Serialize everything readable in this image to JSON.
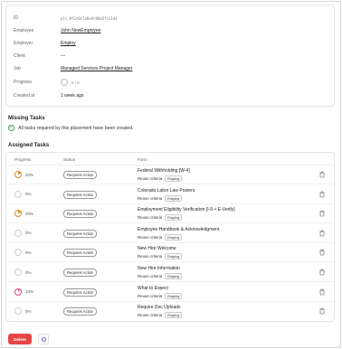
{
  "details": {
    "rows": [
      {
        "label": "ID",
        "value": "plc_8f2c0c7a6e4c9bb3f1c1d4"
      },
      {
        "label": "Employee",
        "value": "John NewEmployee"
      },
      {
        "label": "Employer",
        "value": "Employ"
      },
      {
        "label": "Client",
        "value": "—"
      },
      {
        "label": "Job",
        "value": "Managed Services Project Manager"
      },
      {
        "label": "Progress",
        "value": "0 / 8"
      },
      {
        "label": "Created at",
        "value": "1 week ago"
      }
    ]
  },
  "missing_tasks": {
    "title": "Missing Tasks",
    "message": "All tasks required by this placement have been created."
  },
  "assigned_tasks": {
    "title": "Assigned Tasks",
    "columns": {
      "progress": "Progress",
      "status": "Status",
      "form": "Form"
    },
    "rows": [
      {
        "progress": "20%",
        "progress_value": 0.2,
        "ring_color": "#e48a2a",
        "status": "Requires Action",
        "form": "Federal Withholding [W-4]",
        "reuse_label": "Reuse criteria",
        "reuse_value": "Employ"
      },
      {
        "progress": "0%",
        "progress_value": 0.0,
        "ring_color": "#cccccc",
        "status": "Requires Action",
        "form": "Colorado Labor Law Posters",
        "reuse_label": "Reuse criteria",
        "reuse_value": "Employ"
      },
      {
        "progress": "20%",
        "progress_value": 0.2,
        "ring_color": "#e48a2a",
        "status": "Requires Action",
        "form": "Employment Eligibility Verification [I-9 + E-Verify]",
        "reuse_label": "Reuse criteria",
        "reuse_value": "Employ"
      },
      {
        "progress": "0%",
        "progress_value": 0.0,
        "ring_color": "#cccccc",
        "status": "Requires Action",
        "form": "Employee Handbook & Acknowledgment",
        "reuse_label": "Reuse criteria",
        "reuse_value": "Employ"
      },
      {
        "progress": "0%",
        "progress_value": 0.0,
        "ring_color": "#cccccc",
        "status": "Requires Action",
        "form": "New Hire Welcome",
        "reuse_label": "Reuse criteria",
        "reuse_value": "Employ"
      },
      {
        "progress": "0%",
        "progress_value": 0.0,
        "ring_color": "#cccccc",
        "status": "Requires Action",
        "form": "New Hire Information",
        "reuse_label": "Reuse criteria",
        "reuse_value": "Employ"
      },
      {
        "progress": "10%",
        "progress_value": 0.1,
        "ring_color": "#e0457b",
        "status": "Requires Action",
        "form": "What to Expect",
        "reuse_label": "Reuse criteria",
        "reuse_value": "Employ"
      },
      {
        "progress": "0%",
        "progress_value": 0.0,
        "ring_color": "#cccccc",
        "status": "Requires Action",
        "form": "Require Doc Uploads",
        "reuse_label": "Reuse criteria",
        "reuse_value": "Employ"
      }
    ]
  },
  "footer": {
    "delete_label": "Delete"
  },
  "colors": {
    "danger": "#e64545",
    "success": "#3a9a52",
    "accent": "#7d5cc8"
  }
}
